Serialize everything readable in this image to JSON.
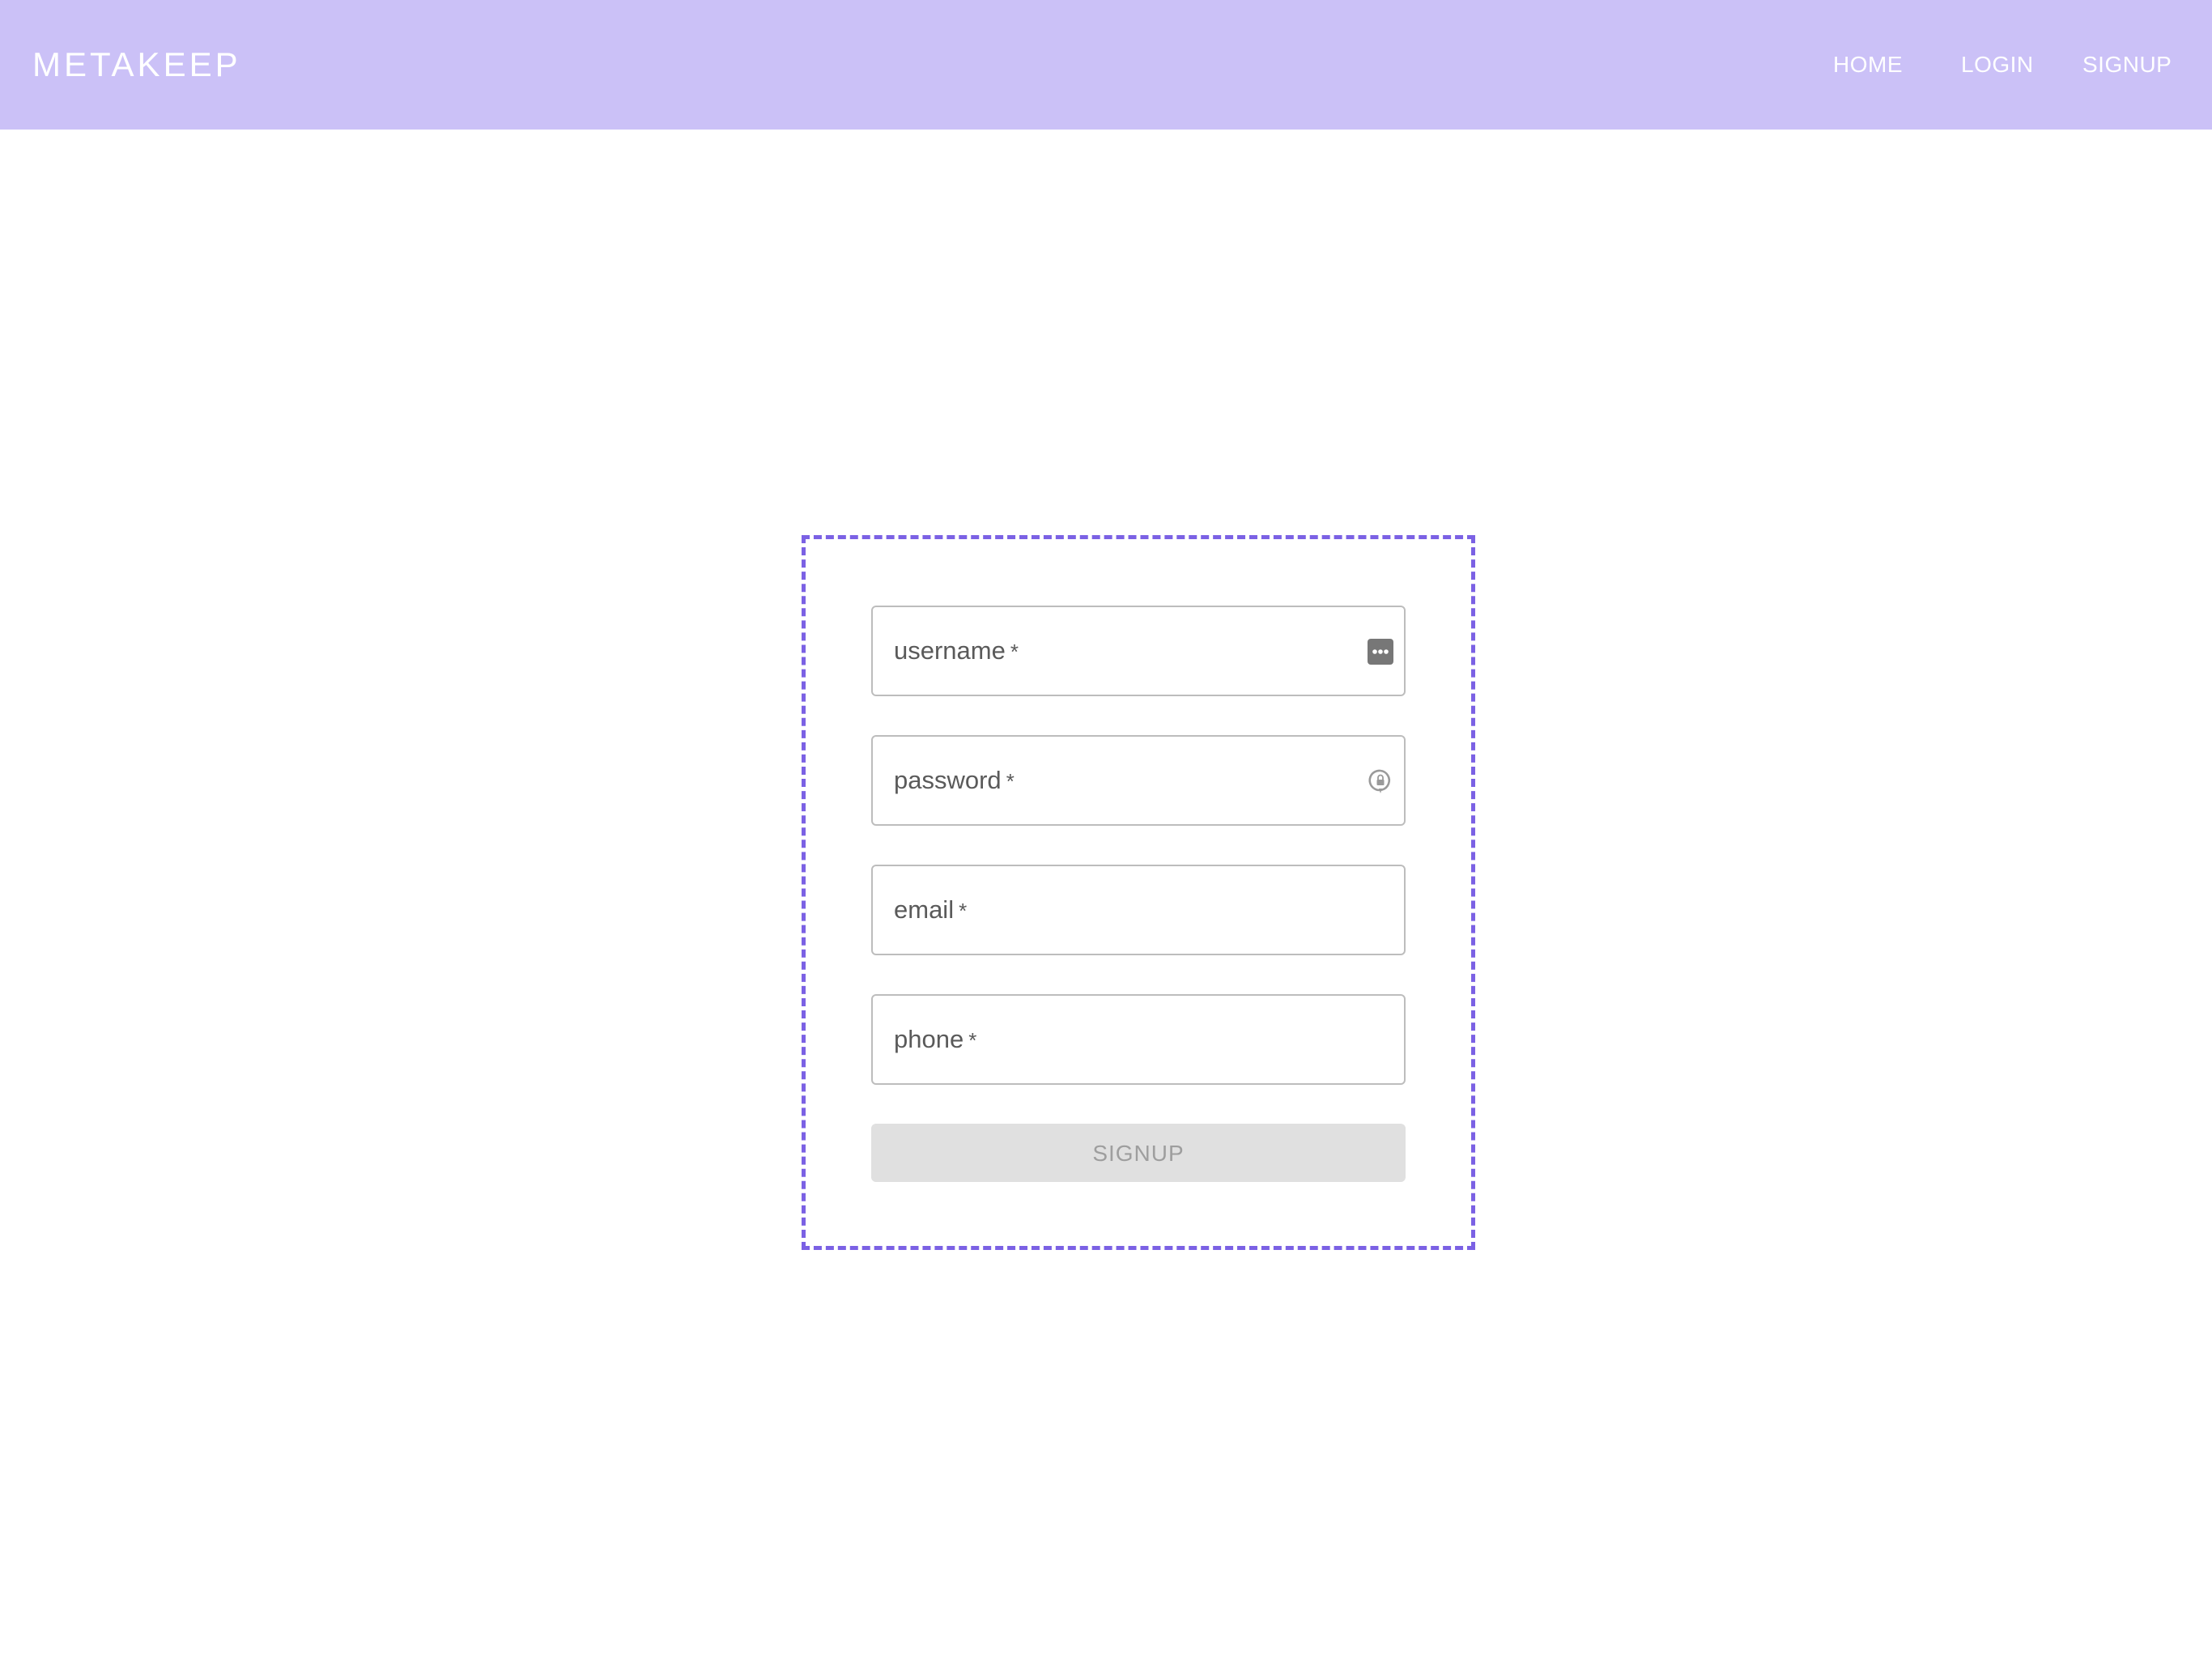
{
  "header": {
    "brand": "METAKEEP",
    "nav": {
      "home": "HOME",
      "login": "LOGIN",
      "signup": "SIGNUP"
    },
    "background_color": "#cbc1f7"
  },
  "form": {
    "border_color": "#7b61e4",
    "fields": {
      "username": {
        "label": "username",
        "required_mark": "*",
        "value": "",
        "icon": "more-dots-icon"
      },
      "password": {
        "label": "password",
        "required_mark": "*",
        "value": "",
        "icon": "password-lock-icon"
      },
      "email": {
        "label": "email",
        "required_mark": "*",
        "value": ""
      },
      "phone": {
        "label": "phone",
        "required_mark": "*",
        "value": ""
      }
    },
    "submit": {
      "label": "SIGNUP",
      "state": "disabled"
    }
  }
}
